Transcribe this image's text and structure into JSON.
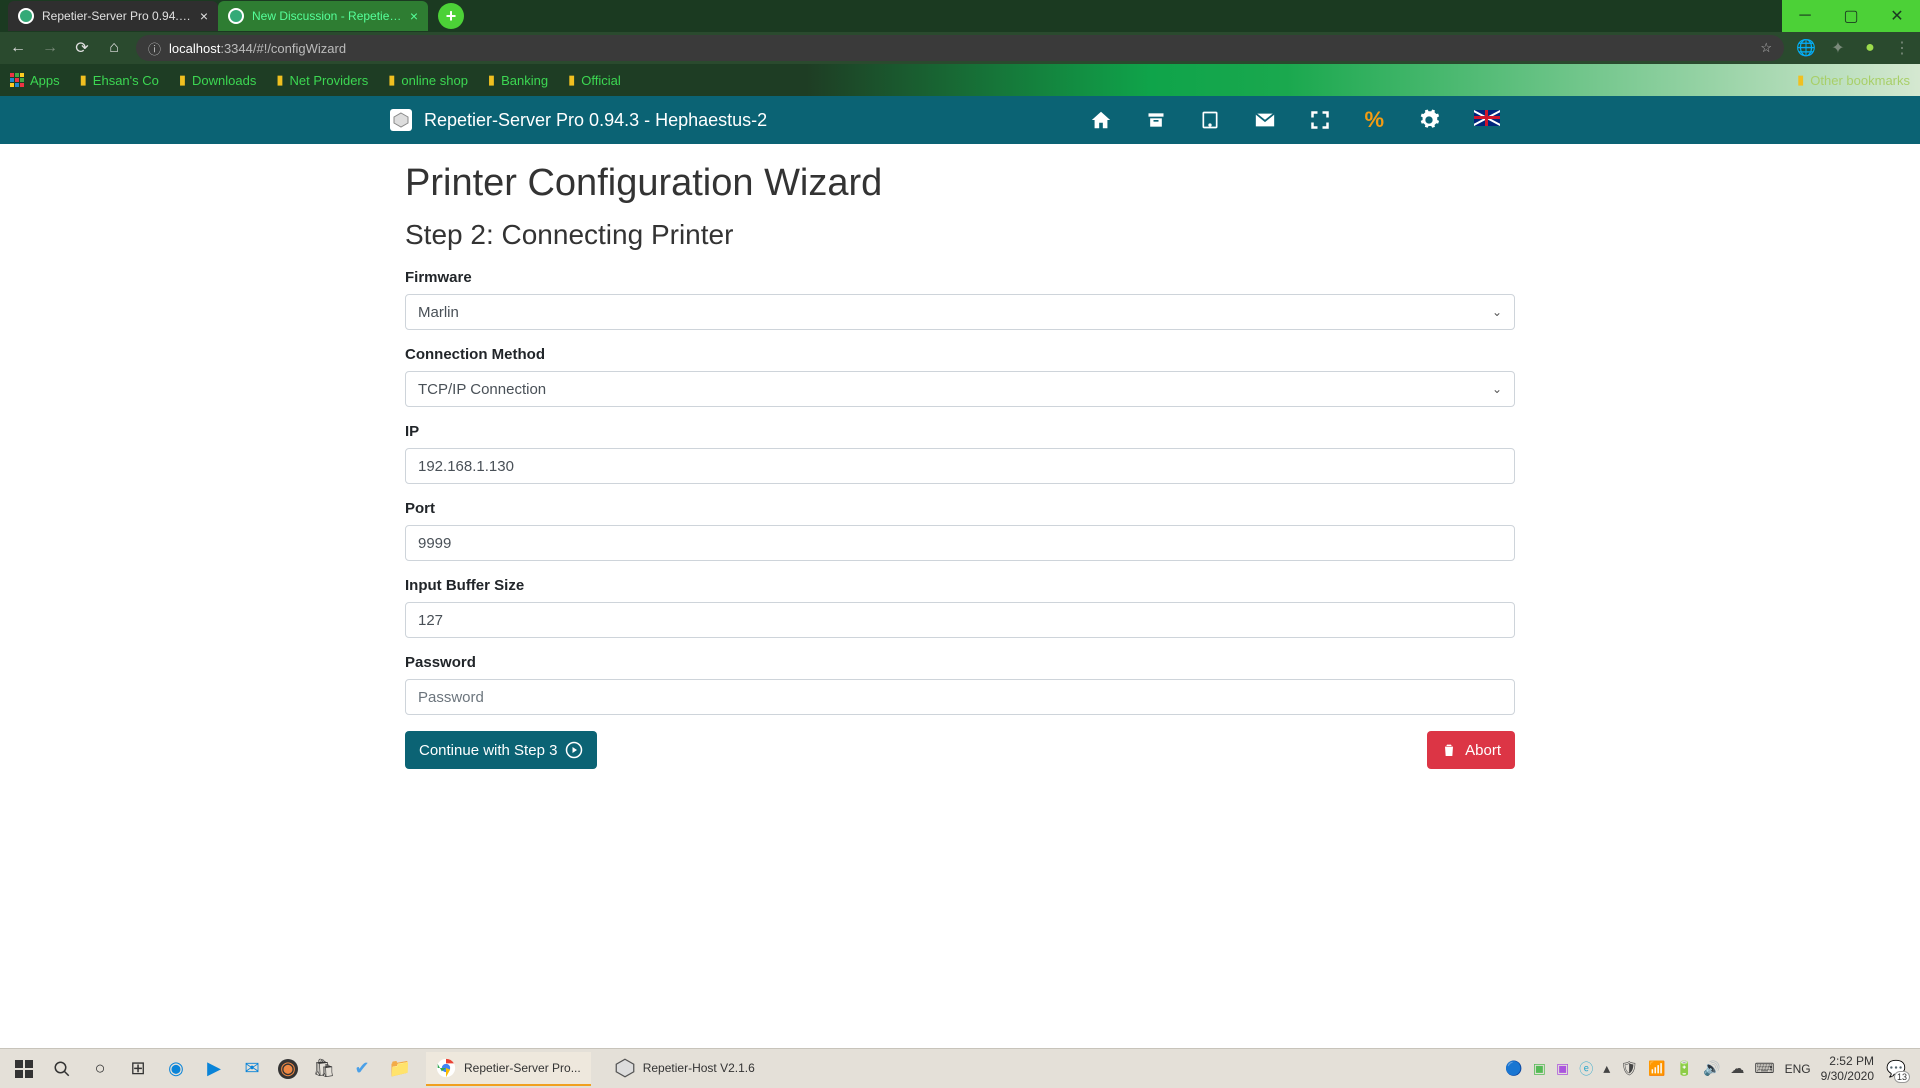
{
  "browser": {
    "tabs": [
      {
        "title": "Repetier-Server Pro 0.94.3 - Heph",
        "active": true
      },
      {
        "title": "New Discussion - Repetier-Forum",
        "active": false
      }
    ],
    "url_info_icon": "ⓘ",
    "url_host": "localhost",
    "url_port_path": ":3344/#!/configWizard",
    "bookmarks": [
      "Apps",
      "Ehsan's Co",
      "Downloads",
      "Net Providers",
      "online shop",
      "Banking",
      "Official"
    ],
    "other_bookmarks": "Other bookmarks"
  },
  "app": {
    "title": "Repetier-Server Pro 0.94.3 - Hephaestus-2"
  },
  "page": {
    "heading": "Printer Configuration Wizard",
    "subheading": "Step 2: Connecting Printer",
    "fields": {
      "firmware_label": "Firmware",
      "firmware_value": "Marlin",
      "connection_label": "Connection Method",
      "connection_value": "TCP/IP Connection",
      "ip_label": "IP",
      "ip_value": "192.168.1.130",
      "port_label": "Port",
      "port_value": "9999",
      "buffer_label": "Input Buffer Size",
      "buffer_value": "127",
      "password_label": "Password",
      "password_placeholder": "Password"
    },
    "continue_label": "Continue with Step 3",
    "abort_label": "Abort"
  },
  "taskbar": {
    "apps": [
      {
        "label": "Repetier-Server Pro...",
        "active": true
      },
      {
        "label": "Repetier-Host V2.1.6",
        "active": false
      }
    ],
    "lang": "ENG",
    "time": "2:52 PM",
    "date": "9/30/2020",
    "notif_count": "13"
  }
}
